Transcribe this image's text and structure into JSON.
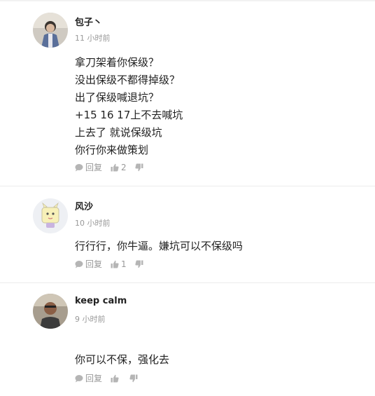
{
  "comments": [
    {
      "author": "包子丶",
      "time": "11 小时前",
      "lines": [
        "拿刀架着你保级？",
        "没出保级不都得掉级？",
        "出了保级喊退坑？",
        "+15 16 17上不去喊坑",
        "上去了 就说保级坑",
        "你行你来做策划"
      ],
      "reply_label": "回复",
      "likes": "2"
    },
    {
      "author": "风沙",
      "time": "10 小时前",
      "lines": [
        "行行行，你牛逼。嫌坑可以不保级吗"
      ],
      "reply_label": "回复",
      "likes": "1"
    },
    {
      "author": "keep calm",
      "time": "9 小时前",
      "lines": [
        "你可以不保，强化去"
      ],
      "reply_label": "回复",
      "likes": ""
    }
  ],
  "icons": {
    "reply": "speech-bubble-icon",
    "like": "thumbs-up-icon",
    "dislike": "thumbs-down-icon"
  },
  "colors": {
    "meta": "#999999",
    "text": "#222222",
    "divider": "#ececec"
  }
}
